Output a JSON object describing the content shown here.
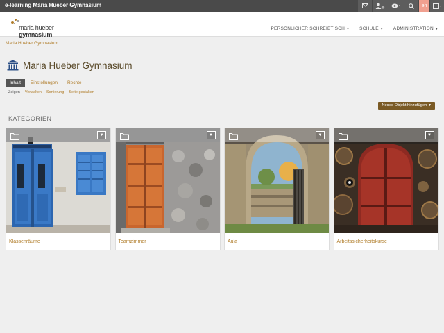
{
  "topbar": {
    "title": "e-learning Maria Hueber Gymnasium",
    "lang": "en",
    "icons": [
      "mail-icon",
      "user-icon",
      "eye-icon",
      "search-icon",
      "avatar-icon"
    ]
  },
  "header": {
    "logo_text_1": "maria hueber",
    "logo_text_2": "gymnasium",
    "nav": [
      {
        "label": "Persönlicher Schreibtisch"
      },
      {
        "label": "Schule"
      },
      {
        "label": "Administration"
      }
    ]
  },
  "breadcrumb": "Maria Hueber Gymnasium",
  "page": {
    "title": "Maria Hueber Gymnasium"
  },
  "tabs": [
    {
      "label": "Inhalt"
    },
    {
      "label": "Einstellungen"
    },
    {
      "label": "Rechte"
    }
  ],
  "subtabs": [
    {
      "label": "Zeigen"
    },
    {
      "label": "Verwalten"
    },
    {
      "label": "Sortierung"
    },
    {
      "label": "Seite gestalten"
    }
  ],
  "new_object_button": "Neues Objekt hinzufügen",
  "section_title": "KATEGORIEN",
  "categories": [
    {
      "label": "Klassenräume"
    },
    {
      "label": "Teamzimmer"
    },
    {
      "label": "Aula"
    },
    {
      "label": "Arbeitssicherheitskurse"
    }
  ],
  "colors": {
    "accent": "#b07d2a",
    "topbar": "#4a4a4a",
    "button": "#7a5a25"
  }
}
